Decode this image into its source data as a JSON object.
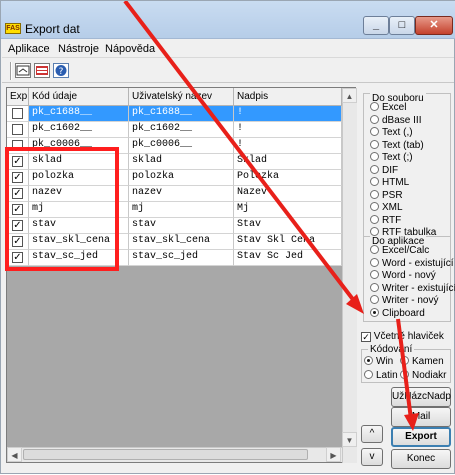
{
  "window": {
    "title": "Export dat",
    "app_icon_text": "FAS"
  },
  "menu": {
    "items": [
      "Aplikace",
      "Nástroje",
      "Nápověda"
    ]
  },
  "toolbar": {
    "icons": [
      "export-icon",
      "table-icon",
      "help-icon"
    ]
  },
  "grid": {
    "headers": [
      "Exp",
      "Kód údaje",
      "Uživatelský název",
      "Nadpis"
    ],
    "rows": [
      {
        "checked": false,
        "code": "pk_c1688__",
        "name": "pk_c1688__",
        "title": "!",
        "selected": true
      },
      {
        "checked": false,
        "code": "pk_c1602__",
        "name": "pk_c1602__",
        "title": "!",
        "selected": false
      },
      {
        "checked": false,
        "code": "pk_c0006__",
        "name": "pk_c0006__",
        "title": "!",
        "selected": false
      },
      {
        "checked": true,
        "code": "sklad",
        "name": "sklad",
        "title": "Sklad",
        "selected": false
      },
      {
        "checked": true,
        "code": "polozka",
        "name": "polozka",
        "title": "Polozka",
        "selected": false
      },
      {
        "checked": true,
        "code": "nazev",
        "name": "nazev",
        "title": "Nazev",
        "selected": false
      },
      {
        "checked": true,
        "code": "mj",
        "name": "mj",
        "title": "Mj",
        "selected": false
      },
      {
        "checked": true,
        "code": "stav",
        "name": "stav",
        "title": "Stav",
        "selected": false
      },
      {
        "checked": true,
        "code": "stav_skl_cena",
        "name": "stav_skl_cena",
        "title": "Stav Skl Cena",
        "selected": false
      },
      {
        "checked": true,
        "code": "stav_sc_jed",
        "name": "stav_sc_jed",
        "title": "Stav Sc Jed",
        "selected": false
      }
    ]
  },
  "do_souboru": {
    "label": "Do souboru",
    "options": [
      "Excel",
      "dBase III",
      "Text (,)",
      "Text (tab)",
      "Text (;)",
      "DIF",
      "HTML",
      "PSR",
      "XML",
      "RTF",
      "RTF tabulka"
    ]
  },
  "do_aplikace": {
    "label": "Do aplikace",
    "options": [
      "Excel/Calc",
      "Word - existující",
      "Word - nový",
      "Writer - existující",
      "Writer - nový",
      "Clipboard"
    ],
    "selected": "Clipboard"
  },
  "options": {
    "include_headers_label": "Včetně hlaviček",
    "include_headers": true,
    "encoding_label": "Kódování",
    "encodings": [
      "Win",
      "Kamen",
      "Latin",
      "Nodiakr"
    ],
    "selected_encoding": "Win"
  },
  "buttons": {
    "uz_nadp": "UžNázcNadp",
    "mail": "Mail",
    "export": "Export",
    "konec": "Konec",
    "up": "^",
    "down": "v"
  },
  "colors": {
    "selection": "#3399ff",
    "highlight_box": "#ff1e1e",
    "arrow": "#e8201a"
  }
}
